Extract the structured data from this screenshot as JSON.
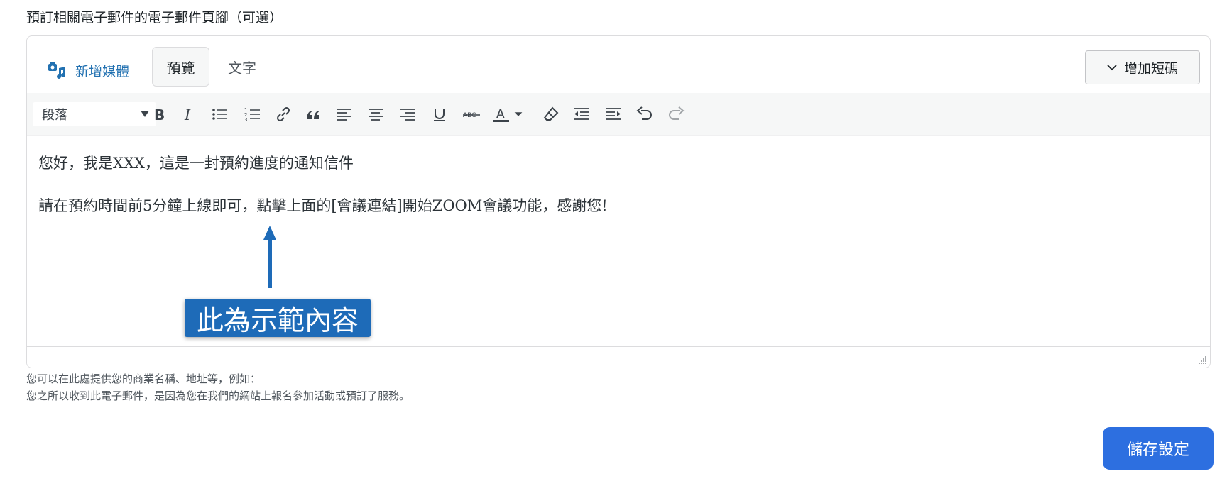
{
  "field_label": "預訂相關電子郵件的電子郵件頁腳（可選）",
  "editor": {
    "add_media_label": "新增媒體",
    "tabs": [
      {
        "label": "預覽",
        "active": true
      },
      {
        "label": "文字",
        "active": false
      }
    ],
    "shortcode_label": "增加短碼",
    "format_select_value": "段落",
    "toolbar_icons": [
      "bold-icon",
      "italic-icon",
      "bullet-list-icon",
      "numbered-list-icon",
      "link-icon",
      "blockquote-icon",
      "align-left-icon",
      "align-center-icon",
      "align-right-icon",
      "underline-icon",
      "strikethrough-icon",
      "text-color-icon",
      "text-color-dropdown-icon",
      "clear-formatting-icon",
      "outdent-icon",
      "indent-icon",
      "undo-icon",
      "redo-icon"
    ],
    "content": [
      "您好，我是XXX，這是一封預約進度的通知信件",
      "請在預約時間前5分鐘上線即可，點擊上面的[會議連結]開始ZOOM會議功能，感謝您!"
    ],
    "annotation": "此為示範內容"
  },
  "description": [
    "您可以在此處提供您的商業名稱、地址等，例如：",
    "您之所以收到此電子郵件，是因為您在我們的網站上報名參加活動或預訂了服務。"
  ],
  "save_button_label": "儲存設定",
  "colors": {
    "accent_link": "#2271b1",
    "annotation_bg": "#1e6bb8",
    "save_button_bg": "#2d6fe0",
    "text_color_bar": "#3c434a"
  }
}
